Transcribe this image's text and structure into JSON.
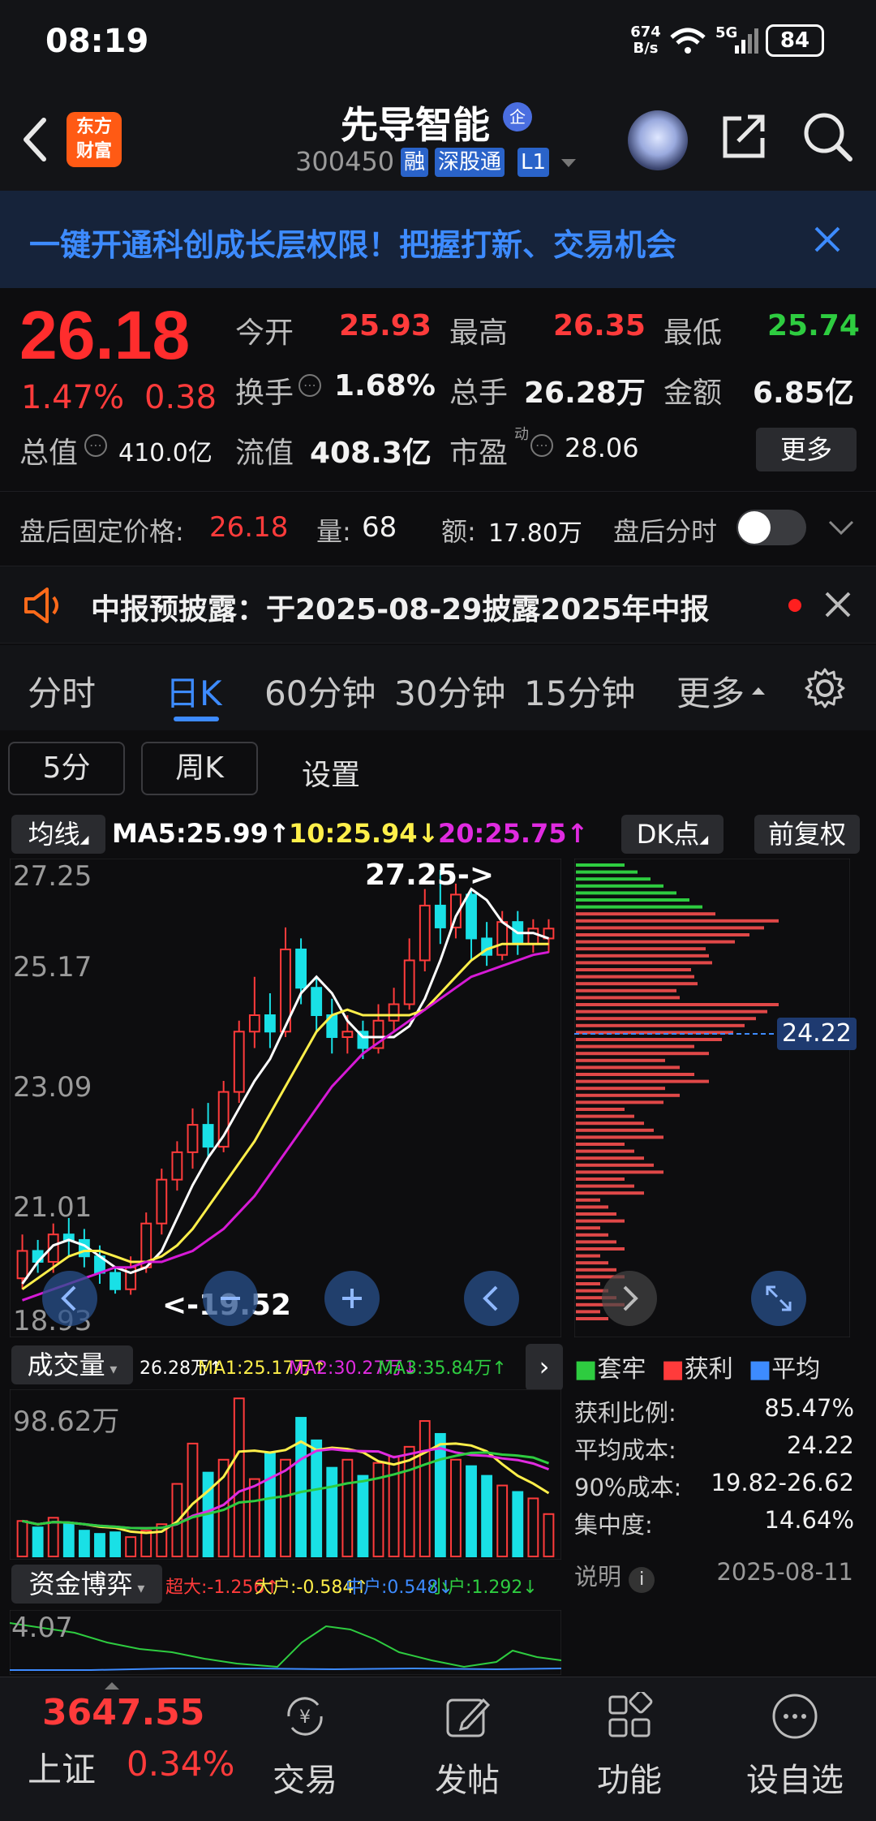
{
  "status": {
    "time": "08:19",
    "net_speed_value": "674",
    "net_speed_unit": "B/s",
    "network": "5G",
    "battery": "84"
  },
  "header": {
    "logo_line1": "东方",
    "logo_line2": "财富",
    "name": "先导智能",
    "badge": "企",
    "code": "300450",
    "tags": [
      "融",
      "深股通",
      "L1"
    ]
  },
  "banner": {
    "text": "一键开通科创成长层权限！把握打新、交易机会"
  },
  "quote": {
    "price": "26.18",
    "change_pct": "1.47%",
    "change": "0.38",
    "open_label": "今开",
    "open": "25.93",
    "high_label": "最高",
    "high": "26.35",
    "low_label": "最低",
    "low": "25.74",
    "turnover_label": "换手",
    "turnover": "1.68%",
    "volume_label": "总手",
    "volume": "26.28万",
    "amount_label": "金额",
    "amount": "6.85亿",
    "mktcap_label": "总值",
    "mktcap": "410.0亿",
    "float_label": "流值",
    "float": "408.3亿",
    "pe_label": "市盈",
    "pe_sup": "动",
    "pe": "28.06",
    "more": "更多"
  },
  "after_hours": {
    "price_label": "盘后固定价格:",
    "price": "26.18",
    "vol_label": "量:",
    "vol": "68",
    "amt_label": "额:",
    "amt": "17.80万",
    "toggle_label": "盘后分时"
  },
  "notice": {
    "text": "中报预披露：于2025-08-29披露2025年中报"
  },
  "tabs": [
    "分时",
    "日K",
    "60分钟",
    "30分钟",
    "15分钟",
    "更多"
  ],
  "subtabs": [
    "5分",
    "周K",
    "设置"
  ],
  "ma": {
    "label": "均线",
    "ma5": "MA5:25.99↑",
    "ma10": "10:25.94↓",
    "ma20": "20:25.75↑",
    "dk": "DK点",
    "adjust": "前复权"
  },
  "colors": {
    "up": "#ff3b3b",
    "down": "#19e0e6",
    "ma5": "#ffffff",
    "ma10": "#ffef4a",
    "ma20": "#d61ad6",
    "accent": "#3d8bff"
  },
  "chart_data": [
    {
      "type": "candlestick",
      "y_ticks": [
        "27.25",
        "25.17",
        "23.09",
        "21.01",
        "18.93"
      ],
      "ylim": [
        18.93,
        27.25
      ],
      "annotations": {
        "max": "27.25->",
        "min": "<-19.52"
      },
      "series": [
        {
          "name": "MA5",
          "values": [
            19.7,
            20.1,
            20.4,
            20.5,
            20.4,
            20.2,
            20.0,
            19.9,
            20.0,
            20.3,
            20.9,
            21.5,
            22.0,
            22.4,
            22.9,
            23.4,
            23.8,
            24.4,
            25.0,
            25.3,
            25.0,
            24.5,
            24.2,
            24.2,
            24.2,
            24.4,
            24.9,
            25.6,
            26.4,
            26.9,
            26.7,
            26.3,
            26.1,
            26.1,
            26.0
          ]
        },
        {
          "name": "10",
          "values": [
            19.6,
            19.8,
            20.0,
            20.2,
            20.3,
            20.3,
            20.2,
            20.1,
            20.1,
            20.2,
            20.4,
            20.7,
            21.1,
            21.5,
            21.9,
            22.3,
            22.8,
            23.3,
            23.8,
            24.3,
            24.6,
            24.7,
            24.6,
            24.6,
            24.6,
            24.6,
            24.7,
            25.0,
            25.3,
            25.6,
            25.8,
            25.9,
            25.9,
            25.9,
            25.9
          ]
        },
        {
          "name": "20",
          "values": [
            19.4,
            19.5,
            19.6,
            19.7,
            19.8,
            19.9,
            20.0,
            20.0,
            20.1,
            20.1,
            20.2,
            20.3,
            20.5,
            20.7,
            21.0,
            21.3,
            21.7,
            22.1,
            22.5,
            22.9,
            23.3,
            23.6,
            23.9,
            24.1,
            24.3,
            24.5,
            24.7,
            24.9,
            25.1,
            25.3,
            25.4,
            25.5,
            25.6,
            25.7,
            25.75
          ]
        }
      ],
      "candles": [
        [
          19.8,
          20.3,
          20.6,
          19.6
        ],
        [
          20.3,
          20.1,
          20.5,
          19.9
        ],
        [
          20.1,
          20.6,
          20.8,
          19.9
        ],
        [
          20.6,
          20.5,
          20.9,
          20.2
        ],
        [
          20.5,
          20.2,
          20.7,
          20.0
        ],
        [
          20.2,
          19.9,
          20.4,
          19.7
        ],
        [
          19.9,
          19.6,
          20.0,
          19.52
        ],
        [
          19.6,
          20.0,
          20.2,
          19.5
        ],
        [
          20.0,
          20.8,
          21.0,
          19.9
        ],
        [
          20.8,
          21.6,
          21.8,
          20.6
        ],
        [
          21.6,
          22.1,
          22.3,
          21.4
        ],
        [
          22.1,
          22.6,
          22.9,
          21.8
        ],
        [
          22.6,
          22.2,
          23.0,
          22.0
        ],
        [
          22.2,
          23.2,
          23.4,
          22.1
        ],
        [
          23.2,
          24.3,
          24.5,
          23.0
        ],
        [
          24.3,
          24.6,
          25.3,
          24.0
        ],
        [
          24.6,
          24.3,
          25.0,
          24.0
        ],
        [
          24.3,
          25.8,
          26.2,
          24.2
        ],
        [
          25.8,
          25.1,
          26.0,
          24.8
        ],
        [
          25.1,
          24.6,
          25.3,
          24.3
        ],
        [
          24.6,
          24.2,
          24.9,
          23.9
        ],
        [
          24.2,
          24.3,
          24.6,
          23.9
        ],
        [
          24.3,
          24.0,
          24.5,
          23.8
        ],
        [
          24.0,
          24.5,
          24.8,
          23.9
        ],
        [
          24.5,
          24.8,
          25.1,
          24.3
        ],
        [
          24.8,
          25.6,
          26.0,
          24.7
        ],
        [
          25.6,
          26.6,
          26.9,
          25.4
        ],
        [
          26.6,
          26.2,
          27.25,
          25.9
        ],
        [
          26.2,
          26.8,
          27.0,
          26.0
        ],
        [
          26.8,
          26.0,
          26.9,
          25.6
        ],
        [
          26.0,
          25.7,
          26.3,
          25.5
        ],
        [
          25.7,
          26.3,
          26.5,
          25.6
        ],
        [
          26.3,
          25.9,
          26.5,
          25.7
        ],
        [
          25.9,
          26.18,
          26.35,
          25.74
        ],
        [
          26.0,
          26.18,
          26.35,
          25.74
        ]
      ]
    },
    {
      "type": "bar",
      "title": "成交量",
      "y_ticks": [
        "98.62万"
      ],
      "legend": {
        "vol": "26.28万↑",
        "ma1": "MA1:25.17万↑",
        "ma2": "MA2:30.27万↓",
        "ma3": "MA3:35.84万↑"
      },
      "values": [
        22,
        18,
        24,
        20,
        16,
        14,
        15,
        12,
        16,
        20,
        45,
        70,
        52,
        60,
        98,
        48,
        64,
        60,
        86,
        72,
        55,
        60,
        50,
        58,
        62,
        68,
        84,
        76,
        60,
        56,
        50,
        44,
        40,
        36,
        26.28
      ]
    },
    {
      "type": "line",
      "title": "资金博弈",
      "y_ticks": [
        "4.07"
      ],
      "legend": {
        "xl": "超大:-1.256↑",
        "big": "大户:-0.584↑",
        "mid": "中户:0.548↓",
        "small": "小户:1.292↓"
      }
    }
  ],
  "chip": {
    "avg_line": "24.22",
    "legend": [
      "套牢",
      "获利",
      "平均"
    ],
    "rows": [
      {
        "label": "获利比例:",
        "value": "85.47%"
      },
      {
        "label": "平均成本:",
        "value": "24.22"
      },
      {
        "label": "90%成本:",
        "value": "19.82-26.62"
      },
      {
        "label": "集中度:",
        "value": "14.64%"
      }
    ],
    "note_label": "说明",
    "date": "2025-08-11"
  },
  "bottom": {
    "index_value": "3647.55",
    "index_name": "上证",
    "index_change": "0.34%",
    "nav": [
      "交易",
      "发帖",
      "功能",
      "设自选"
    ]
  }
}
